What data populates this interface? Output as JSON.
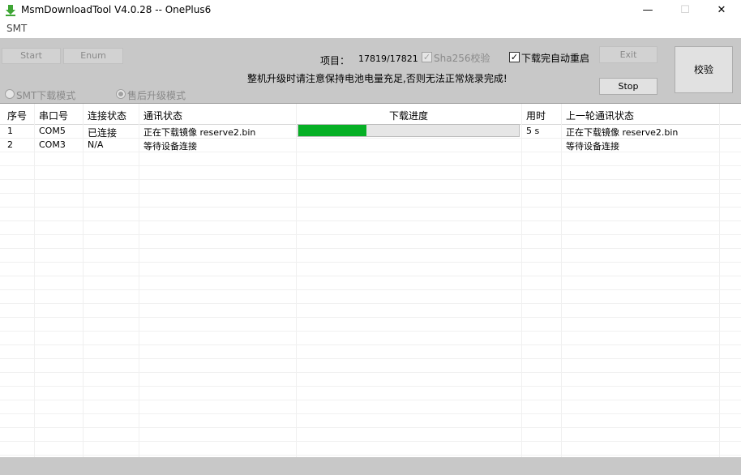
{
  "window": {
    "title": "MsmDownloadTool V4.0.28 -- OnePlus6",
    "minimize_glyph": "—",
    "maximize_glyph": "☐",
    "close_glyph": "✕",
    "icon": "download-arrow-icon",
    "icon_color": "#3fa535"
  },
  "menu": {
    "smt_label": "SMT"
  },
  "toolbar": {
    "start_label": "Start",
    "enum_label": "Enum",
    "project_label": "项目：",
    "project_value": "17819/17821",
    "sha256_label": "Sha256校验",
    "sha256_checked": true,
    "auto_reboot_label": "下载完自动重启",
    "auto_reboot_checked": true,
    "exit_label": "Exit",
    "stop_label": "Stop",
    "verify_label": "校验",
    "warning_text": "整机升级时请注意保持电池电量充足,否则无法正常烧录完成!",
    "smt_mode_label": "SMT下载模式",
    "aftersales_mode_label": "售后升级模式"
  },
  "table": {
    "headers": [
      "序号",
      "串口号",
      "连接状态",
      "通讯状态",
      "下载进度",
      "用时",
      "上一轮通讯状态"
    ],
    "rows": [
      {
        "index": "1",
        "port": "COM5",
        "connection": "已连接",
        "comm_status": "正在下载镜像 reserve2.bin",
        "progress": 0.31,
        "time": "5 s",
        "prev_status": "正在下载镜像 reserve2.bin"
      },
      {
        "index": "2",
        "port": "COM3",
        "connection": "N/A",
        "comm_status": "等待设备连接",
        "progress": null,
        "time": "",
        "prev_status": "等待设备连接"
      }
    ]
  },
  "colors": {
    "progress_fill": "#06b025",
    "toolbar_bg": "#c8c8c8"
  }
}
